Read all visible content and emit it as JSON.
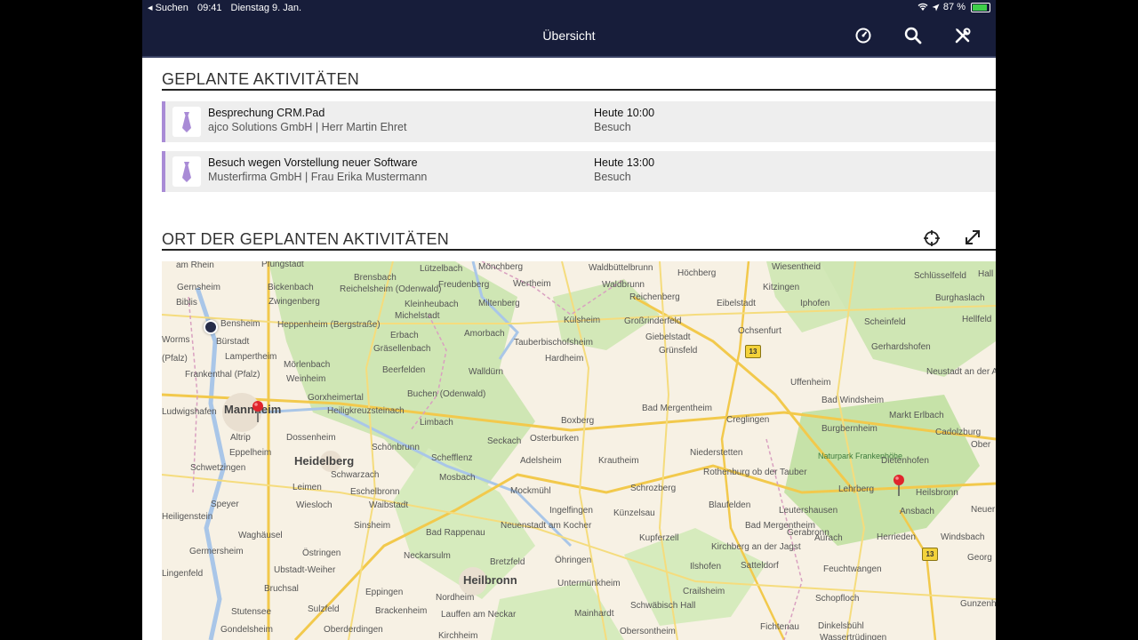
{
  "status": {
    "back_label": "◂ Suchen",
    "time": "09:41",
    "date": "Dienstag 9. Jan.",
    "battery": "87 %",
    "battery_level": 0.87
  },
  "nav": {
    "title": "Übersicht",
    "icons": [
      "dashboard-icon",
      "search-icon",
      "tools-icon"
    ]
  },
  "planned": {
    "heading": "GEPLANTE AKTIVITÄTEN",
    "items": [
      {
        "title": "Besprechung CRM.Pad",
        "subtitle": "ajco Solutions GmbH | Herr Martin Ehret",
        "time": "Heute 10:00",
        "type": "Besuch"
      },
      {
        "title": "Besuch wegen Vorstellung neuer Software",
        "subtitle": "Musterfirma GmbH | Frau Erika Mustermann",
        "time": "Heute 13:00",
        "type": "Besuch"
      }
    ]
  },
  "location": {
    "heading": "ORT DER GEPLANTEN AKTIVITÄTEN",
    "icons": [
      "crosshair-icon",
      "expand-icon"
    ]
  },
  "map": {
    "places": [
      "am Rhein",
      "Pfungstadt",
      "Lützelbach",
      "Mönchberg",
      "Waldbüttelbrunn",
      "Höchberg",
      "Wiesentheid",
      "Schlüsselfeld",
      "Hall",
      "Gernsheim",
      "Bickenbach",
      "Brensbach",
      "Freudenberg",
      "Wertheim",
      "Waldbrunn",
      "Kitzingen",
      "Zwingenberg",
      "Reichelsheim (Odenwald)",
      "Kleinheubach",
      "Miltenberg",
      "Reichenberg",
      "Eibelstadt",
      "Iphofen",
      "Burghaslach",
      "Biblis",
      "Bensheim",
      "Heppenheim (Bergstraße)",
      "Michelstadt",
      "Külsheim",
      "Großrinderfeld",
      "Ochsenfurt",
      "Scheinfeld",
      "Hellfeld",
      "Worms",
      "Bürstadt",
      "Erbach",
      "Amorbach",
      "Tauberbischofsheim",
      "Giebelstadt",
      "Lampertheim",
      "Gräsellenbach",
      "Hardheim",
      "Grünsfeld",
      "Gerhardshofen",
      "(Pfalz)",
      "Mörlenbach",
      "Frankenthal (Pfalz)",
      "Weinheim",
      "Beerfelden",
      "Walldürn",
      "Uffenheim",
      "Neustadt an der Aisch",
      "Gorxheimertal",
      "Buchen (Odenwald)",
      "Bad Windsheim",
      "Ludwigshafen",
      "Mannheim",
      "Heiligkreuzsteinach",
      "Bad Mergentheim",
      "Creglingen",
      "Markt Erlbach",
      "Limbach",
      "Boxberg",
      "Dossenheim",
      "Burgbernheim",
      "Cadolzburg",
      "Ober",
      "Altrip",
      "Eppelheim",
      "Seckach",
      "Osterburken",
      "Schönbrunn",
      "Niederstetten",
      "Heidelberg",
      "Schefflenz",
      "Adelsheim",
      "Krautheim",
      "Naturpark Frankenhöhe",
      "Dietenhofen",
      "Schwetzingen",
      "Rothenburg ob der Tauber",
      "Schwarzach",
      "Mosbach",
      "Lehrberg",
      "Heilsbronn",
      "Leimen",
      "Eschelbronn",
      "Mockmühl",
      "Schrozberg",
      "Blaufelden",
      "Leutershausen",
      "Ansbach",
      "Speyer",
      "Wiesloch",
      "Waibstadt",
      "Ingelfingen",
      "Neuer",
      "Künzelsau",
      "Heiligenstein",
      "Sinsheim",
      "Bad Rappenau",
      "Neuenstadt am Kocher",
      "Bad Mergentheim",
      "Gerabronn",
      "Waghäusel",
      "Kupferzell",
      "Aurach",
      "Herrieden",
      "Windsbach",
      "Germersheim",
      "Östringen",
      "Neckarsulm",
      "Kirchberg an der Jagst",
      "Georg",
      "Ubstadt-Weiher",
      "Bretzfeld",
      "Öhringen",
      "Satteldorf",
      "Ilshofen",
      "Feuchtwangen",
      "Lingenfeld",
      "Heilbronn",
      "Untermünkheim",
      "Crailsheim",
      "Bruchsal",
      "Eppingen",
      "Schopfloch",
      "Gunzenh",
      "Stutensee",
      "Sulzfeld",
      "Brackenheim",
      "Nordheim",
      "Lauffen am Neckar",
      "Mainhardt",
      "Schwäbisch Hall",
      "Dinkelsbühl",
      "Gondelsheim",
      "Oberderdingen",
      "Kirchheim",
      "Obersontheim",
      "Fichtenau",
      "Wassertrüdingen"
    ],
    "highway_label": "13"
  }
}
